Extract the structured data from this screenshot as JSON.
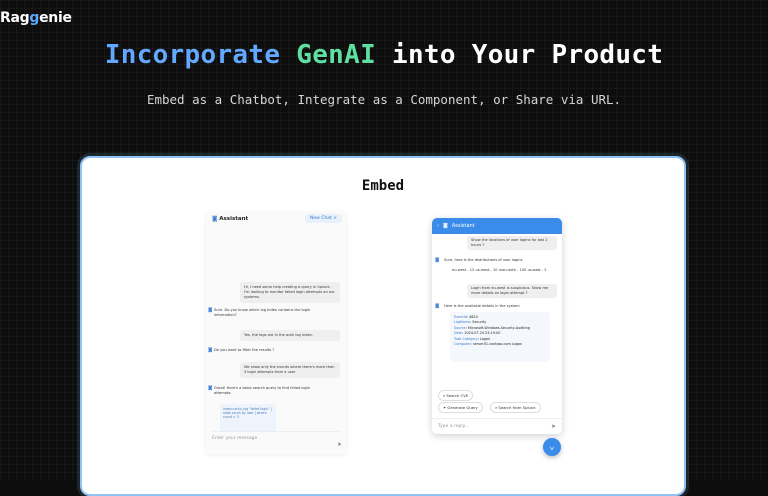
{
  "brand": {
    "prefix": "Rag",
    "accent": "g",
    "suffix": "enie"
  },
  "hero": {
    "title_part1": "Incorporate",
    "title_part2": "GenAI",
    "title_part3": "into Your Product",
    "subtitle": "Embed as a Chatbot, Integrate as a Component, or Share via URL."
  },
  "panel": {
    "title": "Embed"
  },
  "left_widget": {
    "header": "Assistant",
    "new_chat": "New Chat ×",
    "messages": [
      {
        "role": "user",
        "text": "Hi, I need some help creating a query in Splunk. I'm looking to monitor failed login attempts on our systems."
      },
      {
        "role": "bot",
        "text": "Sure. Do you know which log index contains the login information?"
      },
      {
        "role": "user",
        "text": "Yes, the logs are in the auth log index."
      },
      {
        "role": "bot",
        "text": "Do you want to filter the results ?"
      },
      {
        "role": "user",
        "text": "We show only the events where there's more than 3 login attempts from a user"
      },
      {
        "role": "bot",
        "text": "Great! Here's a basic search query to find failed login attempts:"
      }
    ],
    "code": "index=auth_log \"failed login\" | stats count by user | where count > 3",
    "input_placeholder": "Enter your message"
  },
  "right_widget": {
    "header": "Assistant",
    "messages": [
      {
        "role": "user",
        "text": "Show the locations of user logins for last 2 hours ?"
      },
      {
        "role": "bot",
        "text": "Sure, here is the distributions of user logins"
      },
      {
        "role": "bot",
        "text": "eu-west - 12   us-west - 10   use-north - 100   us-east - 2"
      },
      {
        "role": "user",
        "text": "Login from eu-west is suspicious. Show me more details on login attempt ?"
      },
      {
        "role": "bot",
        "text": "Here is the available details in the system"
      }
    ],
    "details": [
      {
        "key": "EventId",
        "value": "4624"
      },
      {
        "key": "LogName",
        "value": "Security"
      },
      {
        "key": "Source",
        "value": "Microsoft-Windows-Security-Auditing"
      },
      {
        "key": "Date",
        "value": "2024-07-24 23:19:00"
      },
      {
        "key": "Task Category",
        "value": "Logon"
      },
      {
        "key": "Computer",
        "value": "server01.contoso.com Logon"
      }
    ],
    "chips": [
      "Search CVE",
      "Generate Query",
      "Search from Splunk"
    ],
    "input_placeholder": "Type a reply..."
  }
}
